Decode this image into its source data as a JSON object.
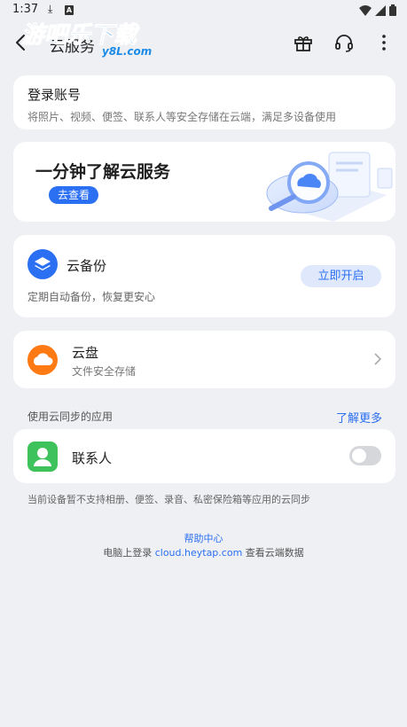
{
  "status_bar": {
    "time": "1:37",
    "download_glyph": "⤓",
    "a_badge": "A",
    "icons": [
      "wifi-icon",
      "signal-icon",
      "battery-icon"
    ]
  },
  "header": {
    "title": "云服务",
    "watermark_main": "游吧乐下载",
    "watermark_sub": "y8L.com",
    "icons": [
      "gift-icon",
      "headset-icon",
      "more-icon"
    ]
  },
  "login_card": {
    "title": "登录账号",
    "description": "将照片、视频、便签、联系人等安全存储在云端，满足多设备使用"
  },
  "promo_card": {
    "title": "一分钟了解云服务",
    "button_label": "去查看"
  },
  "backup_card": {
    "title": "云备份",
    "description": "定期自动备份，恢复更安心",
    "button_label": "立即开启"
  },
  "disk_card": {
    "title": "云盘",
    "description": "文件安全存储"
  },
  "sync_section": {
    "label": "使用云同步的应用",
    "link_label": "了解更多"
  },
  "contacts_row": {
    "label": "联系人",
    "toggle_on": false
  },
  "note": "当前设备暂不支持相册、便签、录音、私密保险箱等应用的云同步",
  "footer": {
    "help_link": "帮助中心",
    "prefix": "电脑上登录",
    "url": "cloud.heytap.com",
    "suffix": "查看云端数据"
  },
  "colors": {
    "accent": "#2b6ff3",
    "backup": "#2b6ff3",
    "disk": "#ff7a12",
    "contacts": "#3ec35c",
    "background": "#eef0f3"
  }
}
